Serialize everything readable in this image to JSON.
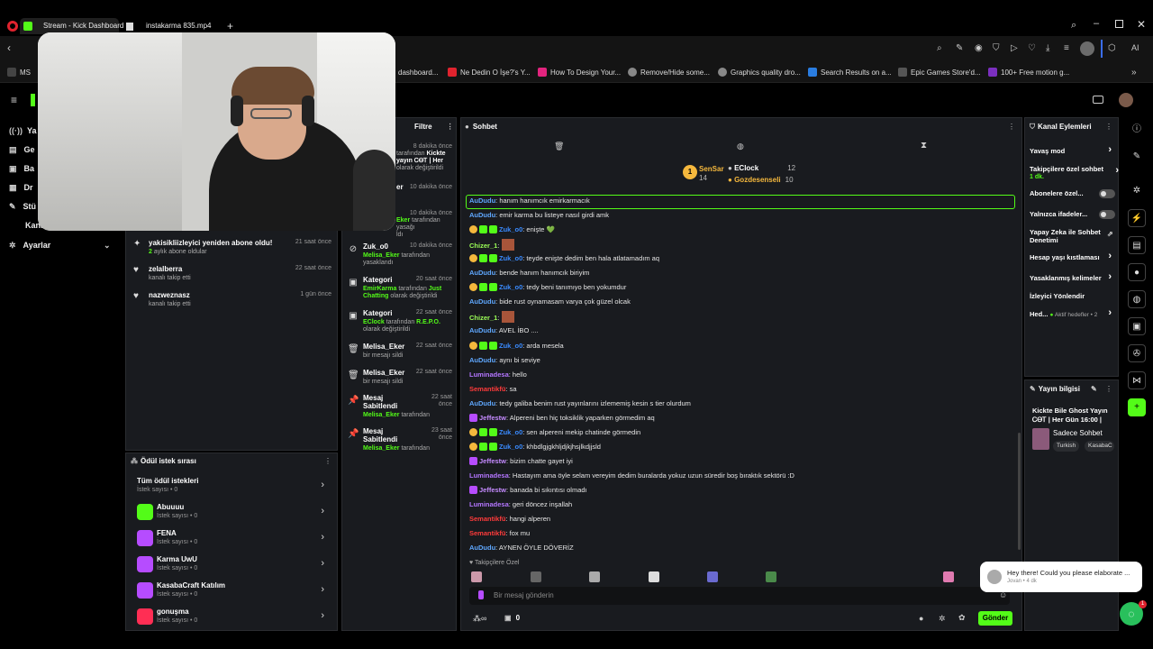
{
  "browser": {
    "tabs": [
      {
        "label": "Stream - Kick Dashboard"
      },
      {
        "label": "instakarma 835.mp4"
      }
    ],
    "bookmarks": [
      {
        "label": "MS"
      },
      {
        "label": "dashboard..."
      },
      {
        "label": "Ne Dedin O İşe?'s Y..."
      },
      {
        "label": "How To Design Your..."
      },
      {
        "label": "Remove/Hide some..."
      },
      {
        "label": "Graphics quality dro..."
      },
      {
        "label": "Search Results on a..."
      },
      {
        "label": "Epic Games Store'd..."
      },
      {
        "label": "100+ Free motion g..."
      }
    ],
    "ai_label": "AI"
  },
  "sidebar": {
    "items": [
      {
        "label": "Ya"
      },
      {
        "label": "Ge"
      },
      {
        "label": "Ba"
      },
      {
        "label": "Dr"
      },
      {
        "label": "Stü"
      },
      {
        "label": "Kanal"
      },
      {
        "label": "Ayarlar"
      }
    ]
  },
  "activity_feed": {
    "items": [
      {
        "title": "yakisikliizleyici yeniden abone oldu!",
        "sub_count": "2",
        "sub": " aylık abone oldular",
        "time": "21 saat önce"
      },
      {
        "title": "zelalberra",
        "sub": "kanalı takip etti",
        "time": "22 saat önce"
      },
      {
        "title": "nazweznasz",
        "sub": "kanalı takip etti",
        "time": "1 gün önce"
      }
    ]
  },
  "mod_log": {
    "filter_label": "Filtre",
    "top_partial": [
      {
        "time": "8 dakika önce",
        "text_a": "tarafından",
        "text_b": "Kickte",
        "text_c": "yayın ᏟᎾᎢ | Her",
        "text_d": "olarak değiştirildi"
      },
      {
        "title": "er",
        "time": "10 dakika önce"
      },
      {
        "time": "10 dakika önce",
        "user": "Eker",
        "text": "tarafından yasağı",
        "text2": "ldı"
      }
    ],
    "items": [
      {
        "title": "Zuk_o0",
        "time": "10 dakika önce",
        "user": "Melisa_Eker",
        "text": "tarafından yasaklandı"
      },
      {
        "title": "Kategori",
        "time": "20 saat önce",
        "user": "EmirKarma",
        "text": "tarafından",
        "target": "Just Chatting",
        "text2": "olarak değiştirildi"
      },
      {
        "title": "Kategori",
        "time": "22 saat önce",
        "user": "EClock",
        "text": "tarafından",
        "target": "R.E.P.O.",
        "text2": "olarak değiştirildi"
      },
      {
        "title": "Melisa_Eker",
        "time": "22 saat önce",
        "text": "bir mesajı sildi"
      },
      {
        "title": "Melisa_Eker",
        "time": "22 saat önce",
        "text": "bir mesajı sildi"
      },
      {
        "title": "Mesaj Sabitlendi",
        "time": "22 saat önce",
        "user": "Melisa_Eker",
        "text": "tarafından"
      },
      {
        "title": "Mesaj Sabitlendi",
        "time": "23 saat önce",
        "user": "Melisa_Eker",
        "text": "tarafından"
      }
    ]
  },
  "rewards": {
    "title": "Ödül istek sırası",
    "all_label": "Tüm ödül istekleri",
    "all_sub": "İstek sayısı • 0",
    "items": [
      {
        "name": "Abuuuu",
        "sub": "İstek sayısı • 0",
        "color": "#53fc18"
      },
      {
        "name": "FENA",
        "sub": "İstek sayısı • 0",
        "color": "#b64cff"
      },
      {
        "name": "Karma UwU",
        "sub": "İstek sayısı • 0",
        "color": "#b64cff"
      },
      {
        "name": "KasabaCraft Katılım",
        "sub": "İstek sayısı • 0",
        "color": "#b64cff"
      },
      {
        "name": "gonuşma",
        "sub": "İstek sayısı • 0",
        "color": "#ff2e54"
      }
    ]
  },
  "chat": {
    "title": "Sohbet",
    "leaderboard": [
      {
        "name": "SenSar",
        "value": "14"
      },
      {
        "name": "EClock",
        "value": "12"
      },
      {
        "name": "Gozdesenseli",
        "value": "10"
      }
    ],
    "messages": [
      {
        "user": "AuDudu",
        "color": "#5fa8ff",
        "text": ": hanım hanımcık emirkarmacık",
        "badges": []
      },
      {
        "user": "AuDudu",
        "color": "#5fa8ff",
        "text": ": emir karma bu listeye nasıl girdi amk",
        "badges": []
      },
      {
        "user": "Zuk_o0",
        "color": "#3a8bff",
        "text": ": enişte 💚",
        "badges": [
          "#f5b83d",
          "#53fc18",
          "#53fc18"
        ]
      },
      {
        "user": "Chizer_1",
        "color": "#9cff57",
        "text": ":",
        "badges": [],
        "emote": true
      },
      {
        "user": "Zuk_o0",
        "color": "#3a8bff",
        "text": ": teyde enişte dedim ben hala atlatamadım aq",
        "badges": [
          "#f5b83d",
          "#53fc18",
          "#53fc18"
        ]
      },
      {
        "user": "AuDudu",
        "color": "#5fa8ff",
        "text": ": bende hanım hanımcık biriyim",
        "badges": []
      },
      {
        "user": "Zuk_o0",
        "color": "#3a8bff",
        "text": ": tedy beni tanımıyo ben yokumdur",
        "badges": [
          "#f5b83d",
          "#53fc18",
          "#53fc18"
        ]
      },
      {
        "user": "AuDudu",
        "color": "#5fa8ff",
        "text": ": bide rust oynamasam varya çok güzel olcak",
        "badges": []
      },
      {
        "user": "Chizer_1",
        "color": "#9cff57",
        "text": ":",
        "badges": [],
        "emote": true
      },
      {
        "user": "AuDudu",
        "color": "#5fa8ff",
        "text": ": AVEL İBO ....",
        "badges": []
      },
      {
        "user": "Zuk_o0",
        "color": "#3a8bff",
        "text": ": arda mesela",
        "badges": [
          "#f5b83d",
          "#53fc18",
          "#53fc18"
        ]
      },
      {
        "user": "AuDudu",
        "color": "#5fa8ff",
        "text": ": aynı bi seviye",
        "badges": []
      },
      {
        "user": "Luminadesa",
        "color": "#b476ff",
        "text": ": hello",
        "badges": []
      },
      {
        "user": "Semantikfü",
        "color": "#ff3b3b",
        "text": ": sa",
        "badges": []
      },
      {
        "user": "AuDudu",
        "color": "#5fa8ff",
        "text": ": tedy galiba benim rust yayınlarını izlememiş kesin s tier olurdum",
        "badges": []
      },
      {
        "user": "Jeffestw",
        "color": "#c58bff",
        "text": ": Alpereni ben hiç toksiklik yaparken görmedim aq",
        "badges": [
          "#b64cff"
        ]
      },
      {
        "user": "Zuk_o0",
        "color": "#3a8bff",
        "text": ": sen alpereni mekip chatinde görmedin",
        "badges": [
          "#f5b83d",
          "#53fc18",
          "#53fc18"
        ]
      },
      {
        "user": "Zuk_o0",
        "color": "#3a8bff",
        "text": ": khbdlgjgkhljdjkjhsjlkdjjsld",
        "badges": [
          "#f5b83d",
          "#53fc18",
          "#53fc18"
        ]
      },
      {
        "user": "Jeffestw",
        "color": "#c58bff",
        "text": ": bizim chatte gayet iyi",
        "badges": [
          "#b64cff"
        ]
      },
      {
        "user": "Luminadesa",
        "color": "#b476ff",
        "text": ": Hastayım ama öyle selam vereyim dedim buralarda yokuz uzun süredir boş bıraktık sektörü :D",
        "badges": []
      },
      {
        "user": "Jeffestw",
        "color": "#c58bff",
        "text": ": banada bi sıkıntısı olmadı",
        "badges": [
          "#b64cff"
        ]
      },
      {
        "user": "Luminadesa",
        "color": "#b476ff",
        "text": ": geri döncez inşallah",
        "badges": []
      },
      {
        "user": "Semantikfü",
        "color": "#ff3b3b",
        "text": ": hangi alperen",
        "badges": []
      },
      {
        "user": "Semantikfü",
        "color": "#ff3b3b",
        "text": ": fox mu",
        "badges": []
      },
      {
        "user": "AuDudu",
        "color": "#5fa8ff",
        "text": ": AYNEN ÖYLE DÖVERİZ",
        "badges": []
      }
    ],
    "followers_only": "Takipçilere Özel",
    "input_placeholder": "Bir mesaj gönderin",
    "points": "0",
    "send_label": "Gönder"
  },
  "channel_actions": {
    "title": "Kanal Eylemleri",
    "items": [
      {
        "label": "Yavaş mod",
        "control": "chevron"
      },
      {
        "label": "Takipçilere özel sohbet",
        "extra": "1 dk.",
        "control": "chevron"
      },
      {
        "label": "Abonelere özel...",
        "control": "toggle"
      },
      {
        "label": "Yalnızca ifadeler...",
        "control": "toggle"
      },
      {
        "label": "Yapay Zeka ile Sohbet Denetimi",
        "control": "external"
      },
      {
        "label": "Hesap yaşı kıstlaması",
        "control": "chevron"
      },
      {
        "label": "Yasaklanmış kelimeler",
        "control": "chevron"
      },
      {
        "label": "İzleyici Yönlendir",
        "control": "none"
      },
      {
        "label": "Hed...",
        "extra": "Aktif hedefler • 2",
        "control": "chevron"
      }
    ]
  },
  "stream_info": {
    "title": "Yayın bilgisi",
    "stream_title": "Kickte Bile Ghost Yayın ᏟᎾᎢ | Her Gün 16:00 |",
    "category": "Sadece Sohbet",
    "tags": [
      "Turkish",
      "KasabaC"
    ]
  },
  "toast": {
    "title": "Hey there!  Could you please elaborate ...",
    "sub": "Jovan • 4 dk"
  },
  "support_badge": "1",
  "colors": {
    "kick_green": "#53fc18",
    "panel": "#191b1f",
    "bg": "#000000"
  }
}
